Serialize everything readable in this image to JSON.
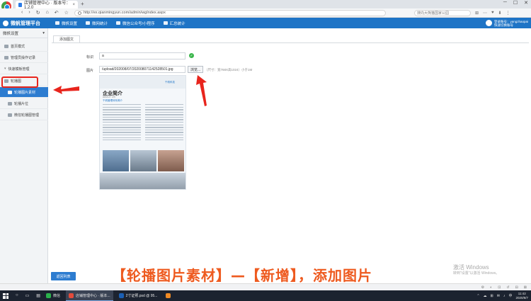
{
  "browser": {
    "tab_title": "店铺管理中心 · 版本号：1.2.0",
    "tab_close": "×",
    "new_tab": "+",
    "url": "http://ex.qianmingyun.com/admin/wgIndex.aspx",
    "search_placeholder": "搜向大熊猫国家公园",
    "nav": {
      "back": "‹",
      "forward": "›",
      "reload": "↻",
      "home": "⌂",
      "undo": "↶",
      "star": "☆"
    },
    "window_controls": {
      "minimize": "─",
      "maximize": "☐",
      "close": "✕"
    },
    "extras": [
      "⊞",
      "⋯",
      "♥",
      "⬇",
      "⋮"
    ],
    "status_icons": [
      "⚙",
      "◐",
      "⊡",
      "↺",
      "⊟",
      "⊠"
    ]
  },
  "app": {
    "brand": "微帆管理平台",
    "top_nav": [
      {
        "label": "微帆设置",
        "icon": "monitor-icon"
      },
      {
        "label": "微网统计",
        "icon": "chart-icon"
      },
      {
        "label": "微信公众号/小程序",
        "icon": "wechat-icon"
      },
      {
        "label": "汇总统计",
        "icon": "summary-icon"
      }
    ],
    "user_line1": "登录账号：yangzhaopai",
    "user_line2": "快速切换账号"
  },
  "sidebar": {
    "title": "微帆设置",
    "title_caret": "▾",
    "items": [
      {
        "label": "首页模式",
        "sub": false,
        "active": false
      },
      {
        "label": "管理员操作记录",
        "sub": false,
        "active": false
      },
      {
        "label": "快速模板管理",
        "sub": false,
        "active": false,
        "caret": "▾"
      },
      {
        "label": "轮播图",
        "sub": false,
        "active": false
      },
      {
        "label": "轮播图片素材",
        "sub": true,
        "active": true
      },
      {
        "label": "轮播片位",
        "sub": true,
        "active": false
      },
      {
        "label": "微信轮播图管理",
        "sub": true,
        "active": false
      }
    ]
  },
  "form": {
    "tab_label": "添加图文",
    "label_field": "标识",
    "label_value": "a",
    "ok_mark": "✓",
    "image_field": "图片",
    "image_path": "/upload/202008/07/202008071142528501.jpg",
    "browse_label": "浏览...",
    "size_hint": "（尺寸：宽768X高1024）小于1M",
    "back_label": "返回列表"
  },
  "preview": {
    "brand": "千帆科技",
    "title": "企业简介",
    "subtitle": "ABOUT US",
    "caption": "千帆管理体系简介"
  },
  "caption": "【轮播图片素材】—【新增】，添加图片",
  "watermark": {
    "line1": "激活 Windows",
    "line2": "转到\"设置\"以激活 Windows。"
  },
  "taskbar": {
    "apps": [
      {
        "label": "微信",
        "color": "#2bb24c",
        "active": false
      },
      {
        "label": "店铺管理中心 · 版本...",
        "color": "#e24b3b",
        "active": true
      },
      {
        "label": "2寸证照.psd @ 95...",
        "color": "#1a5fb4",
        "active": false
      },
      {
        "label": "",
        "color": "#f08a24",
        "active": false
      }
    ],
    "tray_icons": [
      "⌃",
      "☁",
      "⊞",
      "✉",
      "♪",
      "中"
    ],
    "time": "11:42",
    "date": "2020/8/7"
  },
  "colors": {
    "header_blue": "#1e74c6",
    "active_blue": "#2d7cd0",
    "highlight_red": "#e8251d",
    "caption_orange": "#ee5a1f"
  }
}
